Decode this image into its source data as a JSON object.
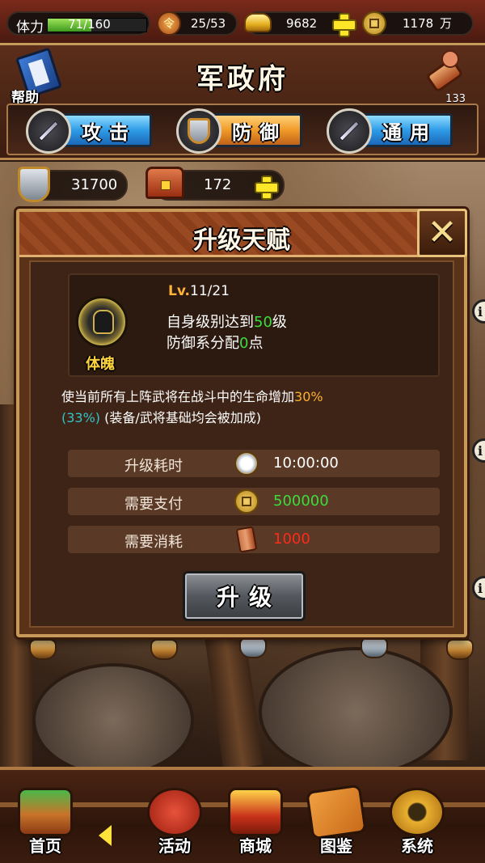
{
  "status_bar": {
    "stamina_label": "体力",
    "stamina_value": "71/160",
    "stamina_fraction": 0.44,
    "orders_value": "25/53",
    "order_icon_glyph": "令",
    "gold_value": "9682",
    "coins_value": "1178",
    "coins_unit": "万"
  },
  "header": {
    "title": "军政府",
    "help_label": "帮助",
    "scroll_count": "133",
    "tabs": [
      {
        "label": "攻击",
        "color": "blue",
        "icon": "crossed-swords-icon"
      },
      {
        "label": "防御",
        "color": "orange",
        "icon": "shield-icon"
      },
      {
        "label": "通用",
        "color": "blue",
        "icon": "sword-shield-icon"
      }
    ]
  },
  "resources": {
    "shield_points": "31700",
    "chest_count": "172"
  },
  "dialog": {
    "title": "升级天赋",
    "close_glyph": "✕",
    "talent": {
      "name": "体魄",
      "level_prefix": "Lv.",
      "level_value": "11/21",
      "req1_prefix": "自身级别达到",
      "req1_value": "50",
      "req1_suffix": "级",
      "req2_prefix": "防御系分配",
      "req2_value": "0",
      "req2_suffix": "点"
    },
    "description": {
      "part1": "使当前所有上阵武将在战斗中的生命增加",
      "value": "30%",
      "next_value": "(33%)",
      "part2": " (装备/武将基础均会被加成)"
    },
    "stats": [
      {
        "label": "升级耗时",
        "icon": "clock-icon",
        "value": "10:00:00",
        "color": "#ffffff"
      },
      {
        "label": "需要支付",
        "icon": "coin-icon",
        "value": "500000",
        "color": "#3ddc3d"
      },
      {
        "label": "需要消耗",
        "icon": "scroll-icon",
        "value": "1000",
        "color": "#ff2a1a"
      }
    ],
    "upgrade_label": "升级"
  },
  "bottom_nav": [
    {
      "label": "首页",
      "icon": "home-icon"
    },
    {
      "label": "活动",
      "icon": "drums-icon"
    },
    {
      "label": "商城",
      "icon": "treasure-chest-icon"
    },
    {
      "label": "图鉴",
      "icon": "cards-icon"
    },
    {
      "label": "系统",
      "icon": "gear-icon"
    }
  ],
  "colors": {
    "accent_gold": "#ffd33a",
    "value_green": "#3ddc3d",
    "value_red": "#ff2a1a",
    "percent_orange": "#ffb12a",
    "percent_teal": "#33c4c8"
  }
}
